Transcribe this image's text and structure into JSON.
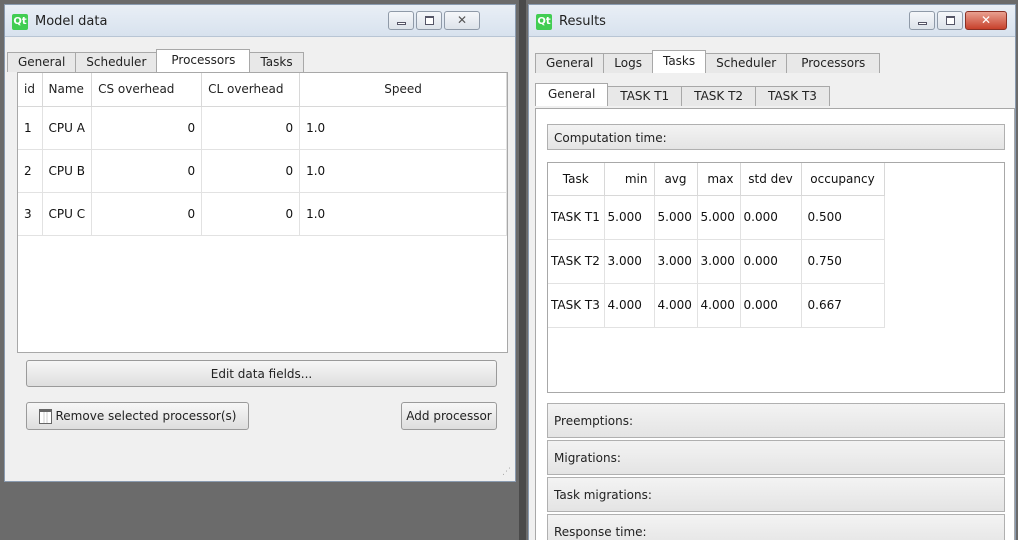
{
  "model_window": {
    "title": "Model data",
    "tabs": [
      "General",
      "Scheduler",
      "Processors",
      "Tasks"
    ],
    "active_tab": "Processors",
    "table": {
      "headers": [
        "id",
        "Name",
        "CS overhead",
        "CL overhead",
        "Speed"
      ],
      "rows": [
        [
          "1",
          "CPU A",
          "0",
          "0",
          "1.0"
        ],
        [
          "2",
          "CPU B",
          "0",
          "0",
          "1.0"
        ],
        [
          "3",
          "CPU C",
          "0",
          "0",
          "1.0"
        ]
      ]
    },
    "edit_button": "Edit data fields...",
    "remove_button": "Remove selected processor(s)",
    "add_button": "Add processor"
  },
  "results_window": {
    "title": "Results",
    "tabs": [
      "General",
      "Logs",
      "Tasks",
      "Scheduler",
      "Processors"
    ],
    "active_tab": "Tasks",
    "subtabs": [
      "General",
      "TASK T1",
      "TASK T2",
      "TASK T3"
    ],
    "active_subtab": "General",
    "computation_label": "Computation time:",
    "table": {
      "headers": [
        "Task",
        "min",
        "avg",
        "max",
        "std dev",
        "occupancy"
      ],
      "rows": [
        [
          "TASK T1",
          "5.000",
          "5.000",
          "5.000",
          "0.000",
          "0.500"
        ],
        [
          "TASK T2",
          "3.000",
          "3.000",
          "3.000",
          "0.000",
          "0.750"
        ],
        [
          "TASK T3",
          "4.000",
          "4.000",
          "4.000",
          "0.000",
          "0.667"
        ]
      ]
    },
    "sections": [
      "Preemptions:",
      "Migrations:",
      "Task migrations:",
      "Response time:"
    ]
  },
  "colors": {
    "qt_logo": "#41cd52",
    "close_button": "#c7412b"
  }
}
